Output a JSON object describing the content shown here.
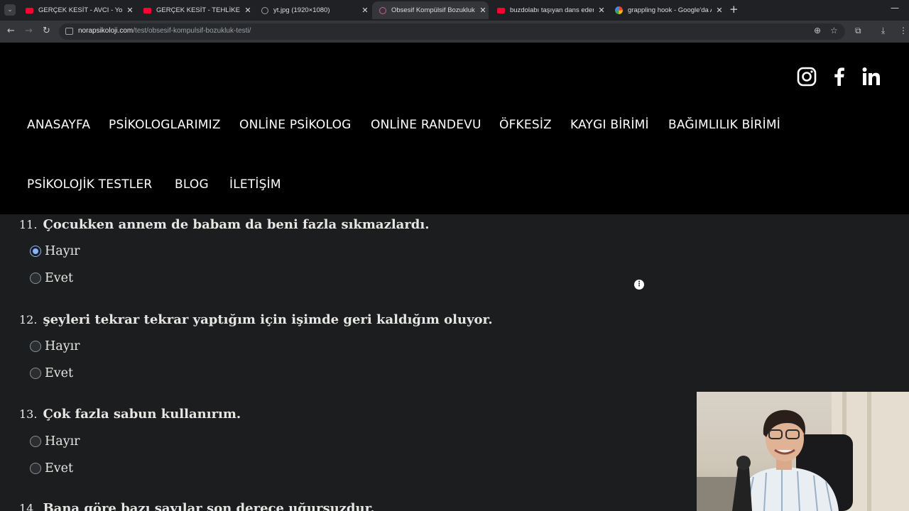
{
  "browser": {
    "tabs": [
      {
        "label": "GERÇEK KESİT - AVCI - YouTube",
        "favicon": "youtube-icon",
        "active": false
      },
      {
        "label": "GERÇEK KESİT - TEHLİKELİ OYU",
        "favicon": "youtube-icon",
        "active": false
      },
      {
        "label": "yt.jpg (1920×1080)",
        "favicon": "globe-icon",
        "active": false
      },
      {
        "label": "Obsesif Kompülsif Bozukluk Tes",
        "favicon": "site-icon",
        "active": true
      },
      {
        "label": "buzdolabı taşıyan dans eden ad",
        "favicon": "youtube-icon",
        "active": false
      },
      {
        "label": "grappling hook - Google'da Ara",
        "favicon": "google-icon",
        "active": false
      }
    ],
    "url_host": "norapsikoloji.com",
    "url_path": "/test/obsesif-kompulsif-bozukluk-testi/"
  },
  "site": {
    "nav": [
      "ANASAYFA",
      "PSİKOLOGLARIMIZ",
      "ONLİNE PSİKOLOG",
      "ONLİNE RANDEVU",
      "ÖFKESİZ",
      "KAYGI BİRİMİ",
      "BAĞIMLILIK BİRİMİ",
      "PSİKOLOJİK TESTLER",
      "BLOG",
      "İLETİŞİM"
    ],
    "social": [
      "instagram-icon",
      "facebook-icon",
      "linkedin-icon"
    ]
  },
  "quiz": {
    "questions": [
      {
        "number": "11.",
        "text": "Çocukken annem de babam da beni fazla sıkmazlardı.",
        "options": [
          "Hayır",
          "Evet"
        ],
        "selected": "Hayır"
      },
      {
        "number": "12.",
        "text": "şeyleri tekrar tekrar yaptığım için işimde geri kaldığım oluyor.",
        "options": [
          "Hayır",
          "Evet"
        ],
        "selected": null
      },
      {
        "number": "13.",
        "text": "Çok fazla sabun kullanırım.",
        "options": [
          "Hayır",
          "Evet"
        ],
        "selected": null
      },
      {
        "number": "14.",
        "text": "Bana göre bazı sayılar son derece uğursuzdur.",
        "options": [],
        "selected": null
      }
    ]
  },
  "colors": {
    "header_bg": "#000000",
    "content_bg": "#1b1d1e",
    "text": "#e8e6e3",
    "radio_checked": "#8ab4f8"
  }
}
